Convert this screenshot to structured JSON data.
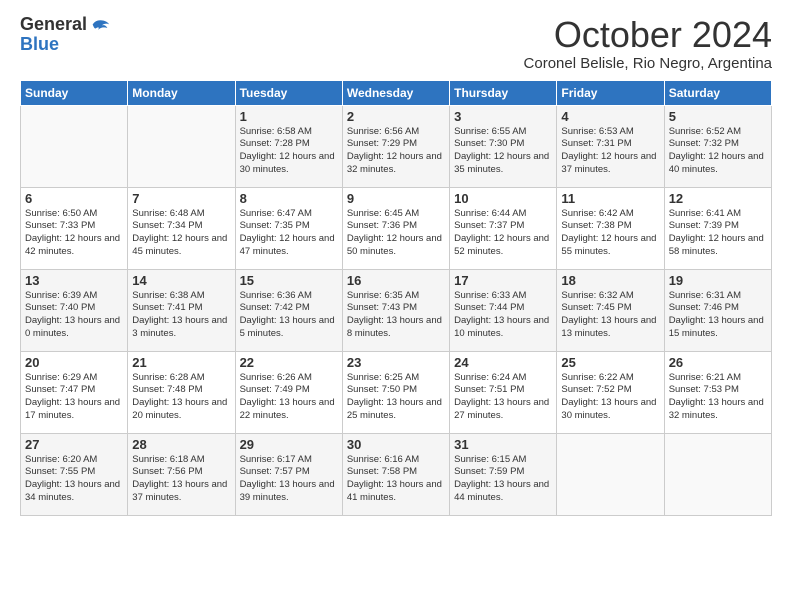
{
  "logo": {
    "general": "General",
    "blue": "Blue"
  },
  "title": "October 2024",
  "subtitle": "Coronel Belisle, Rio Negro, Argentina",
  "days_of_week": [
    "Sunday",
    "Monday",
    "Tuesday",
    "Wednesday",
    "Thursday",
    "Friday",
    "Saturday"
  ],
  "weeks": [
    [
      {
        "day": "",
        "info": ""
      },
      {
        "day": "",
        "info": ""
      },
      {
        "day": "1",
        "info": "Sunrise: 6:58 AM\nSunset: 7:28 PM\nDaylight: 12 hours and 30 minutes."
      },
      {
        "day": "2",
        "info": "Sunrise: 6:56 AM\nSunset: 7:29 PM\nDaylight: 12 hours and 32 minutes."
      },
      {
        "day": "3",
        "info": "Sunrise: 6:55 AM\nSunset: 7:30 PM\nDaylight: 12 hours and 35 minutes."
      },
      {
        "day": "4",
        "info": "Sunrise: 6:53 AM\nSunset: 7:31 PM\nDaylight: 12 hours and 37 minutes."
      },
      {
        "day": "5",
        "info": "Sunrise: 6:52 AM\nSunset: 7:32 PM\nDaylight: 12 hours and 40 minutes."
      }
    ],
    [
      {
        "day": "6",
        "info": "Sunrise: 6:50 AM\nSunset: 7:33 PM\nDaylight: 12 hours and 42 minutes."
      },
      {
        "day": "7",
        "info": "Sunrise: 6:48 AM\nSunset: 7:34 PM\nDaylight: 12 hours and 45 minutes."
      },
      {
        "day": "8",
        "info": "Sunrise: 6:47 AM\nSunset: 7:35 PM\nDaylight: 12 hours and 47 minutes."
      },
      {
        "day": "9",
        "info": "Sunrise: 6:45 AM\nSunset: 7:36 PM\nDaylight: 12 hours and 50 minutes."
      },
      {
        "day": "10",
        "info": "Sunrise: 6:44 AM\nSunset: 7:37 PM\nDaylight: 12 hours and 52 minutes."
      },
      {
        "day": "11",
        "info": "Sunrise: 6:42 AM\nSunset: 7:38 PM\nDaylight: 12 hours and 55 minutes."
      },
      {
        "day": "12",
        "info": "Sunrise: 6:41 AM\nSunset: 7:39 PM\nDaylight: 12 hours and 58 minutes."
      }
    ],
    [
      {
        "day": "13",
        "info": "Sunrise: 6:39 AM\nSunset: 7:40 PM\nDaylight: 13 hours and 0 minutes."
      },
      {
        "day": "14",
        "info": "Sunrise: 6:38 AM\nSunset: 7:41 PM\nDaylight: 13 hours and 3 minutes."
      },
      {
        "day": "15",
        "info": "Sunrise: 6:36 AM\nSunset: 7:42 PM\nDaylight: 13 hours and 5 minutes."
      },
      {
        "day": "16",
        "info": "Sunrise: 6:35 AM\nSunset: 7:43 PM\nDaylight: 13 hours and 8 minutes."
      },
      {
        "day": "17",
        "info": "Sunrise: 6:33 AM\nSunset: 7:44 PM\nDaylight: 13 hours and 10 minutes."
      },
      {
        "day": "18",
        "info": "Sunrise: 6:32 AM\nSunset: 7:45 PM\nDaylight: 13 hours and 13 minutes."
      },
      {
        "day": "19",
        "info": "Sunrise: 6:31 AM\nSunset: 7:46 PM\nDaylight: 13 hours and 15 minutes."
      }
    ],
    [
      {
        "day": "20",
        "info": "Sunrise: 6:29 AM\nSunset: 7:47 PM\nDaylight: 13 hours and 17 minutes."
      },
      {
        "day": "21",
        "info": "Sunrise: 6:28 AM\nSunset: 7:48 PM\nDaylight: 13 hours and 20 minutes."
      },
      {
        "day": "22",
        "info": "Sunrise: 6:26 AM\nSunset: 7:49 PM\nDaylight: 13 hours and 22 minutes."
      },
      {
        "day": "23",
        "info": "Sunrise: 6:25 AM\nSunset: 7:50 PM\nDaylight: 13 hours and 25 minutes."
      },
      {
        "day": "24",
        "info": "Sunrise: 6:24 AM\nSunset: 7:51 PM\nDaylight: 13 hours and 27 minutes."
      },
      {
        "day": "25",
        "info": "Sunrise: 6:22 AM\nSunset: 7:52 PM\nDaylight: 13 hours and 30 minutes."
      },
      {
        "day": "26",
        "info": "Sunrise: 6:21 AM\nSunset: 7:53 PM\nDaylight: 13 hours and 32 minutes."
      }
    ],
    [
      {
        "day": "27",
        "info": "Sunrise: 6:20 AM\nSunset: 7:55 PM\nDaylight: 13 hours and 34 minutes."
      },
      {
        "day": "28",
        "info": "Sunrise: 6:18 AM\nSunset: 7:56 PM\nDaylight: 13 hours and 37 minutes."
      },
      {
        "day": "29",
        "info": "Sunrise: 6:17 AM\nSunset: 7:57 PM\nDaylight: 13 hours and 39 minutes."
      },
      {
        "day": "30",
        "info": "Sunrise: 6:16 AM\nSunset: 7:58 PM\nDaylight: 13 hours and 41 minutes."
      },
      {
        "day": "31",
        "info": "Sunrise: 6:15 AM\nSunset: 7:59 PM\nDaylight: 13 hours and 44 minutes."
      },
      {
        "day": "",
        "info": ""
      },
      {
        "day": "",
        "info": ""
      }
    ]
  ]
}
